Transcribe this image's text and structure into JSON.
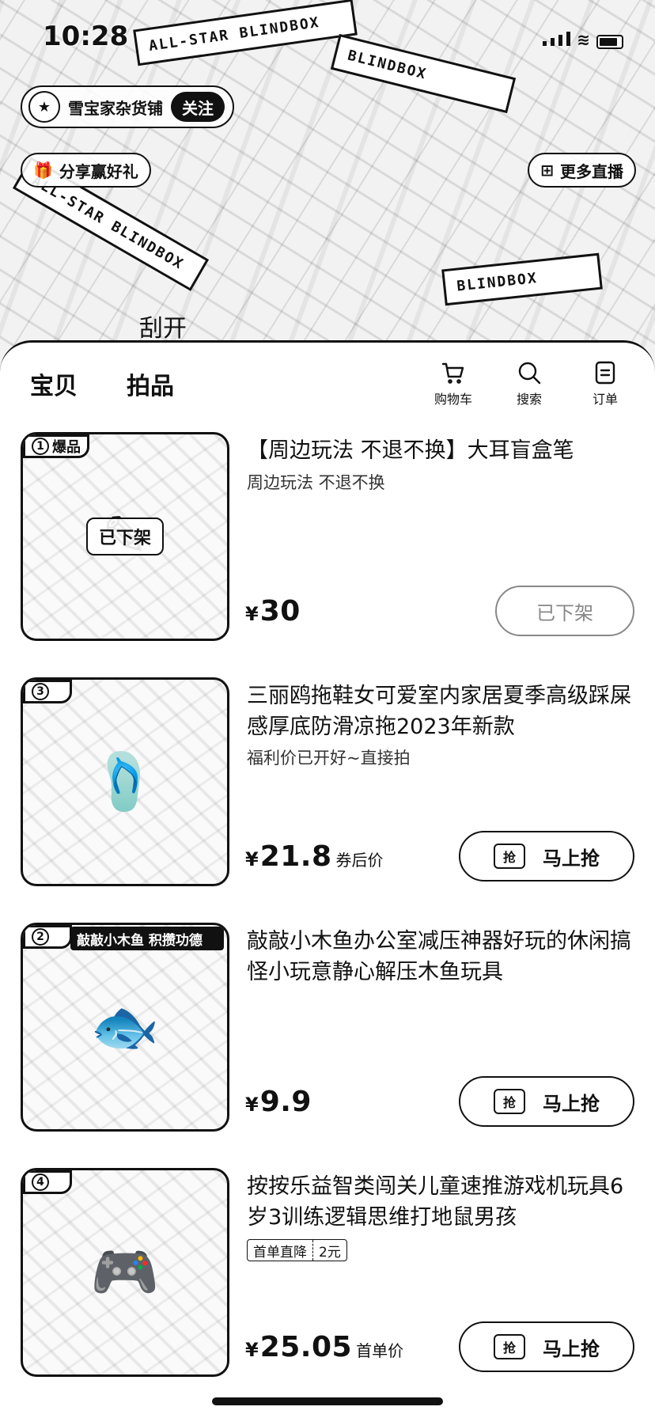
{
  "status_bar": {
    "time": "10:28"
  },
  "live": {
    "shop_name": "雪宝家杂货铺",
    "shop_avatar_icon": "shop-avatar-icon",
    "follow_label": "关注",
    "left_chip_label": "分享赢好礼",
    "right_chip_label": "更多直播",
    "box_texts": [
      "ALL-STAR BLINDBOX",
      "BLINDBOX",
      "BLINDBOX",
      "ALL-STAR BLINDBOX"
    ],
    "note": "刮开"
  },
  "sheet": {
    "tabs": [
      {
        "label": "宝贝"
      },
      {
        "label": "拍品"
      }
    ],
    "actions": [
      {
        "label": "购物车",
        "icon": "cart-icon"
      },
      {
        "label": "搜索",
        "icon": "search-icon"
      },
      {
        "label": "订单",
        "icon": "order-icon"
      }
    ]
  },
  "products": [
    {
      "rank": "1",
      "rank_label": "爆品",
      "status_overlay": "已下架",
      "title": "【周边玩法 不退不换】大耳盲盒笔",
      "subtitle": "周边玩法 不退不换",
      "currency": "¥",
      "price": "30",
      "price_note": "",
      "button_label": "已下架",
      "button_disabled": true
    },
    {
      "rank": "3",
      "title": "三丽鸥拖鞋女可爱室内家居夏季高级踩屎感厚底防滑凉拖2023年新款",
      "subtitle": "福利价已开好~直接拍",
      "currency": "¥",
      "price": "21.8",
      "price_note": "券后价",
      "button_icon_label": "抢",
      "button_label": "马上抢"
    },
    {
      "rank": "2",
      "banner": "敲敲小木鱼 积攒功德",
      "title": "敲敲小木鱼办公室减压神器好玩的休闲搞怪小玩意静心解压木鱼玩具",
      "currency": "¥",
      "price": "9.9",
      "price_note": "",
      "button_icon_label": "抢",
      "button_label": "马上抢"
    },
    {
      "rank": "4",
      "title": "按按乐益智类闯关儿童速推游戏机玩具6岁3训练逻辑思维打地鼠男孩",
      "coupon": {
        "label": "首单直降",
        "amount": "2元"
      },
      "currency": "¥",
      "price": "25.05",
      "price_note": "首单价",
      "button_icon_label": "抢",
      "button_label": "马上抢"
    }
  ]
}
